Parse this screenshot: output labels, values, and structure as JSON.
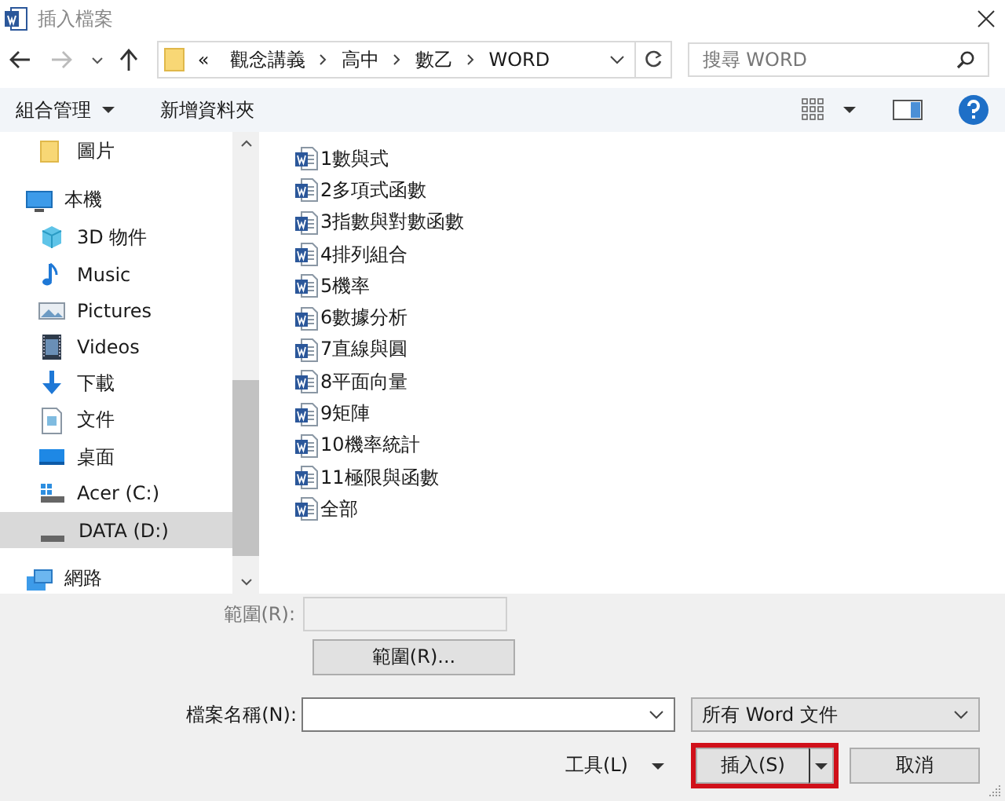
{
  "window": {
    "title": "插入檔案"
  },
  "address": {
    "overflow": "«",
    "segments": [
      "觀念講義",
      "高中",
      "數乙",
      "WORD"
    ]
  },
  "search": {
    "placeholder": "搜尋 WORD"
  },
  "nav": {
    "forward_disabled": true
  },
  "toolbar": {
    "organize": "組合管理",
    "new_folder": "新增資料夾"
  },
  "sidebar": {
    "continued_children": [
      {
        "label": "圖片",
        "kind": "folder",
        "selected": false
      }
    ],
    "items": [
      {
        "label": "本機",
        "kind": "pc",
        "selected": false,
        "children": [
          {
            "label": "3D 物件",
            "kind": "cube",
            "selected": false
          },
          {
            "label": "Music",
            "kind": "music",
            "selected": false
          },
          {
            "label": "Pictures",
            "kind": "pictures",
            "selected": false
          },
          {
            "label": "Videos",
            "kind": "videos",
            "selected": false
          },
          {
            "label": "下載",
            "kind": "download",
            "selected": false
          },
          {
            "label": "文件",
            "kind": "document",
            "selected": false
          },
          {
            "label": "桌面",
            "kind": "desktop",
            "selected": false
          },
          {
            "label": "Acer (C:)",
            "kind": "system-drive",
            "selected": false
          },
          {
            "label": "DATA (D:)",
            "kind": "drive",
            "selected": true
          }
        ]
      },
      {
        "label": "網路",
        "kind": "network",
        "selected": false
      }
    ]
  },
  "files": [
    {
      "name": "1數與式"
    },
    {
      "name": "2多項式函數"
    },
    {
      "name": "3指數與對數函數"
    },
    {
      "name": "4排列組合"
    },
    {
      "name": "5機率"
    },
    {
      "name": "6數據分析"
    },
    {
      "name": "7直線與圓"
    },
    {
      "name": "8平面向量"
    },
    {
      "name": "9矩陣"
    },
    {
      "name": "10機率統計"
    },
    {
      "name": "11極限與函數"
    },
    {
      "name": "全部"
    }
  ],
  "range": {
    "label": "範圍(R):",
    "disabled": true,
    "button": "範圍(R)..."
  },
  "filename": {
    "label": "檔案名稱(N):"
  },
  "filter": {
    "value": "所有 Word 文件"
  },
  "buttons": {
    "tools": "工具(L)",
    "insert": {
      "label": "插入(S)",
      "highlighted": true
    },
    "cancel": "取消"
  }
}
